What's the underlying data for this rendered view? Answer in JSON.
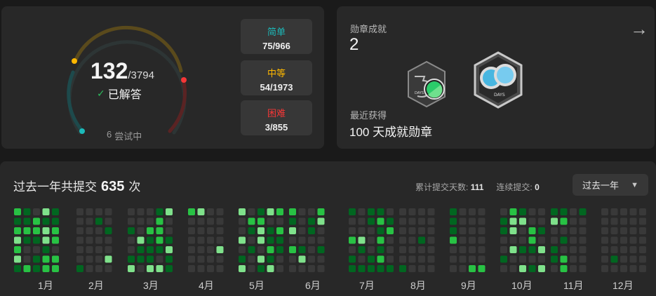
{
  "progress": {
    "solved": "132",
    "total": "/3794",
    "solved_label": "已解答",
    "attempting_count": "6",
    "attempting_label": "尝试中",
    "easy": {
      "name": "简单",
      "value": "75/966",
      "color": "#1cbaba"
    },
    "medium": {
      "name": "中等",
      "value": "54/1973",
      "color": "#ffb800"
    },
    "hard": {
      "name": "困难",
      "value": "3/855",
      "color": "#f63737"
    }
  },
  "badges": {
    "title": "勋章成就",
    "count": "2",
    "arrow_icon": "arrow-right-icon",
    "recent_label": "最近获得",
    "recent_name": "100 天成就勋章",
    "items": [
      {
        "icon": "50-days-badge-icon",
        "text": "DAYS"
      },
      {
        "icon": "100-days-badge-icon",
        "text": "DAYS"
      }
    ]
  },
  "heatmap": {
    "title_prefix": "过去一年共提交",
    "title_count": "635",
    "title_suffix": "次",
    "total_days_label": "累计提交天数:",
    "total_days": "111",
    "streak_label": "连续提交:",
    "streak": "0",
    "range": "过去一年",
    "months": [
      "1月",
      "2月",
      "3月",
      "4月",
      "5月",
      "6月",
      "7月",
      "8月",
      "9月",
      "10月",
      "11月",
      "12月"
    ],
    "colors": [
      "#393939",
      "#016620",
      "#28c244",
      "#7fe18b"
    ]
  }
}
